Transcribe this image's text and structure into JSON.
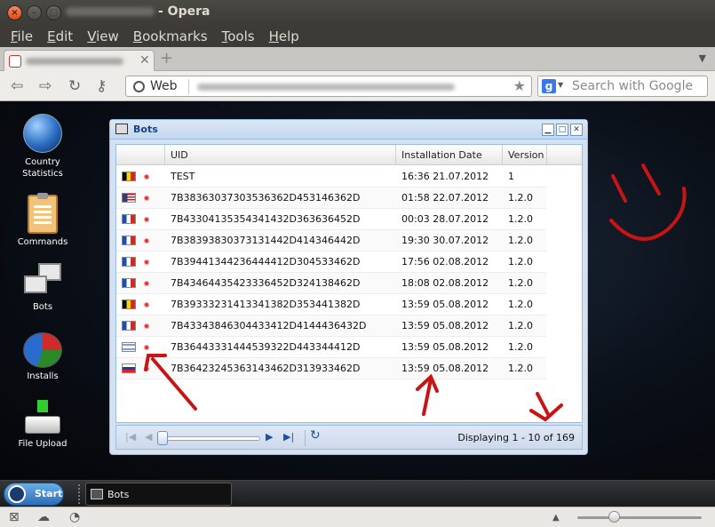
{
  "window": {
    "title_suffix": "- Opera"
  },
  "menu": [
    {
      "first": "F",
      "rest": "ile"
    },
    {
      "first": "E",
      "rest": "dit"
    },
    {
      "first": "V",
      "rest": "iew"
    },
    {
      "first": "B",
      "rest": "ookmarks"
    },
    {
      "first": "T",
      "rest": "ools"
    },
    {
      "first": "H",
      "rest": "elp"
    }
  ],
  "addressbar": {
    "web_label": "Web",
    "search_placeholder": "Search with Google",
    "search_engine": "g"
  },
  "desktop_icons": [
    {
      "label": "Country Statistics",
      "icon": "globe-icon"
    },
    {
      "label": "Commands",
      "icon": "clipboard-icon"
    },
    {
      "label": "Bots",
      "icon": "monitors-icon"
    },
    {
      "label": "Installs",
      "icon": "pie-chart-icon"
    },
    {
      "label": "File Upload",
      "icon": "upload-icon"
    }
  ],
  "bots_window": {
    "title": "Bots",
    "columns": [
      "UID",
      "Installation Date",
      "Version"
    ],
    "rows": [
      {
        "flag": [
          "#000000",
          "#f7d117",
          "#e2231a"
        ],
        "uid": "TEST",
        "date": "16:36 21.07.2012",
        "version": "1"
      },
      {
        "flag": "us",
        "uid": "7B38363037303536362D453146362D",
        "date": "01:58 22.07.2012",
        "version": "1.2.0"
      },
      {
        "flag": [
          "#1f4ea8",
          "#ffffff",
          "#e2231a"
        ],
        "uid": "7B43304135354341432D363636452D",
        "date": "00:03 28.07.2012",
        "version": "1.2.0"
      },
      {
        "flag": [
          "#1f4ea8",
          "#ffffff",
          "#e2231a"
        ],
        "uid": "7B38393830373131442D414346442D",
        "date": "19:30 30.07.2012",
        "version": "1.2.0"
      },
      {
        "flag": [
          "#1f4ea8",
          "#ffffff",
          "#e2231a"
        ],
        "uid": "7B39441344236444412D304533462D",
        "date": "17:56 02.08.2012",
        "version": "1.2.0"
      },
      {
        "flag": [
          "#1f4ea8",
          "#ffffff",
          "#e2231a"
        ],
        "uid": "7B43464435423336452D324138462D",
        "date": "18:08 02.08.2012",
        "version": "1.2.0"
      },
      {
        "flag": [
          "#000000",
          "#f7d117",
          "#e2231a"
        ],
        "uid": "7B39333231413341382D353441382D",
        "date": "13:59 05.08.2012",
        "version": "1.2.0"
      },
      {
        "flag": [
          "#1f4ea8",
          "#ffffff",
          "#e2231a"
        ],
        "uid": "7B43343846304433412D4144436432D",
        "date": "13:59 05.08.2012",
        "version": "1.2.0"
      },
      {
        "flag": "il",
        "uid": "7B36443331444539322D443344412D",
        "date": "13:59 05.08.2012",
        "version": "1.2.0"
      },
      {
        "flag": "si",
        "uid": "7B36423245363143462D313933462D",
        "date": "13:59 05.08.2012",
        "version": "1.2.0"
      }
    ],
    "pager_status": "Displaying 1 - 10 of 169"
  },
  "taskbar": {
    "start_label": "Start",
    "task_label": "Bots"
  }
}
